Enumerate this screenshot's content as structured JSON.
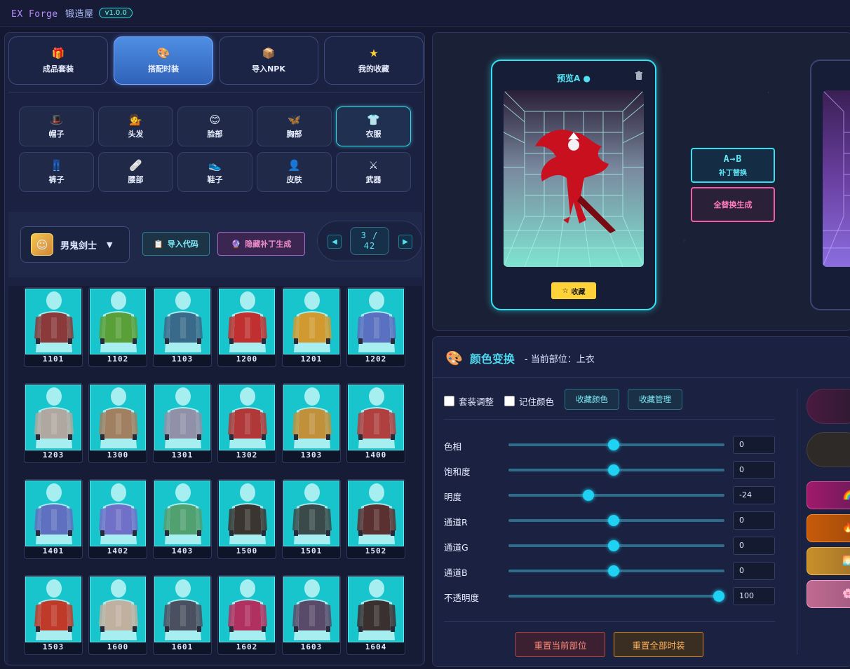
{
  "app": {
    "title_en": "EX Forge",
    "title_cn": "锻造屋",
    "version": "v1.0.0"
  },
  "main_tabs": [
    {
      "label": "成品套装",
      "icon": "gift-icon",
      "glyph": "🎁"
    },
    {
      "label": "搭配时装",
      "icon": "palette-icon",
      "glyph": "🎨"
    },
    {
      "label": "导入NPK",
      "icon": "box-icon",
      "glyph": "📦"
    },
    {
      "label": "我的收藏",
      "icon": "star-icon",
      "glyph": "★"
    }
  ],
  "categories": [
    {
      "label": "帽子",
      "icon": "hat-icon",
      "glyph": "🎩"
    },
    {
      "label": "头发",
      "icon": "hair-icon",
      "glyph": "💁"
    },
    {
      "label": "脸部",
      "icon": "face-icon",
      "glyph": "😊"
    },
    {
      "label": "胸部",
      "icon": "butterfly-icon",
      "glyph": "🦋"
    },
    {
      "label": "衣服",
      "icon": "shirt-icon",
      "glyph": "👕"
    },
    {
      "label": "裤子",
      "icon": "pants-icon",
      "glyph": "👖"
    },
    {
      "label": "腰部",
      "icon": "bandage-icon",
      "glyph": "🩹"
    },
    {
      "label": "鞋子",
      "icon": "shoe-icon",
      "glyph": "👟"
    },
    {
      "label": "皮肤",
      "icon": "person-icon",
      "glyph": "👤"
    },
    {
      "label": "武器",
      "icon": "swords-icon",
      "glyph": "⚔"
    }
  ],
  "character": {
    "name": "男鬼剑士"
  },
  "toolbar": {
    "import_code": "导入代码",
    "hidden_patch": "隐藏补丁生成"
  },
  "pager": {
    "current": "3",
    "slash": "/",
    "total": "42"
  },
  "items": [
    "1101",
    "1102",
    "1103",
    "1200",
    "1201",
    "1202",
    "1203",
    "1300",
    "1301",
    "1302",
    "1303",
    "1400",
    "1401",
    "1402",
    "1403",
    "1500",
    "1501",
    "1502",
    "1503",
    "1600",
    "1601",
    "1602",
    "1603",
    "1604"
  ],
  "item_colors": [
    "#8a3a3a",
    "#5aa038",
    "#3a6a8a",
    "#c03030",
    "#d09a30",
    "#5a70c0",
    "#b0a8a0",
    "#a08060",
    "#9090a8",
    "#b03838",
    "#c0903a",
    "#b04040",
    "#6070c0",
    "#7070c8",
    "#50a070",
    "#3a3530",
    "#3a4a4a",
    "#5a3030",
    "#c03a2a",
    "#c0b0a0",
    "#4a5060",
    "#b03060",
    "#5a4a6a",
    "#3a3030"
  ],
  "preview": {
    "title_a": "预览A",
    "favorite": "收藏",
    "ab_label": "A→B",
    "ab_sub": "补丁替换",
    "replace_all": "全替换生成"
  },
  "color_panel": {
    "title": "颜色变换",
    "subtitle": "- 当前部位：上衣",
    "suit_adjust": "套装调整",
    "remember_color": "记住颜色",
    "fav_color": "收藏颜色",
    "fav_manage": "收藏管理",
    "sliders": [
      {
        "label": "色相",
        "value": "0",
        "pos": 0.5
      },
      {
        "label": "饱和度",
        "value": "0",
        "pos": 0.5
      },
      {
        "label": "明度",
        "value": "-24",
        "pos": 0.38
      },
      {
        "label": "通道R",
        "value": "0",
        "pos": 0.5
      },
      {
        "label": "通道G",
        "value": "0",
        "pos": 0.5
      },
      {
        "label": "通道B",
        "value": "0",
        "pos": 0.5
      },
      {
        "label": "不透明度",
        "value": "100",
        "pos": 1.0
      }
    ],
    "reset_current": "重置当前部位",
    "reset_all": "重置全部时装"
  },
  "colors": {
    "accent": "#33e2f2",
    "pink": "#ee5fa8",
    "panel": "#1b2140"
  }
}
